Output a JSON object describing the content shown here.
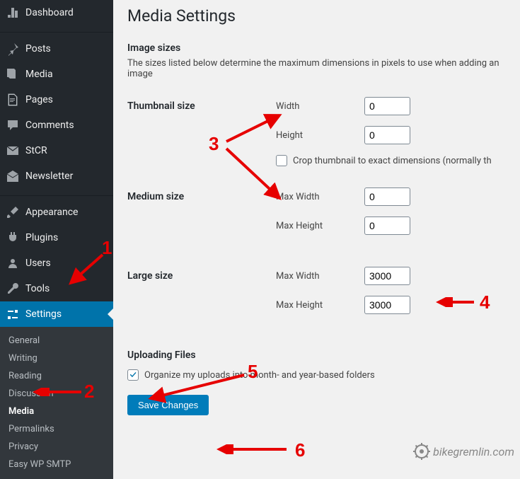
{
  "sidebar": {
    "items": [
      {
        "label": "Dashboard",
        "icon": "dashboard-icon"
      },
      {
        "label": "Posts",
        "icon": "pin-icon"
      },
      {
        "label": "Media",
        "icon": "media-icon"
      },
      {
        "label": "Pages",
        "icon": "page-icon"
      },
      {
        "label": "Comments",
        "icon": "comment-icon"
      },
      {
        "label": "StCR",
        "icon": "email-icon"
      },
      {
        "label": "Newsletter",
        "icon": "envelope-open-icon"
      },
      {
        "label": "Appearance",
        "icon": "brush-icon"
      },
      {
        "label": "Plugins",
        "icon": "plug-icon"
      },
      {
        "label": "Users",
        "icon": "users-icon"
      },
      {
        "label": "Tools",
        "icon": "tools-icon"
      },
      {
        "label": "Settings",
        "icon": "sliders-icon"
      }
    ],
    "submenu": [
      "General",
      "Writing",
      "Reading",
      "Discussion",
      "Media",
      "Permalinks",
      "Privacy",
      "Easy WP SMTP"
    ]
  },
  "page": {
    "title": "Media Settings",
    "section_image_sizes": "Image sizes",
    "desc": "The sizes listed below determine the maximum dimensions in pixels to use when adding an image",
    "thumbnail": {
      "label": "Thumbnail size",
      "width_label": "Width",
      "width_value": "0",
      "height_label": "Height",
      "height_value": "0",
      "crop_label": "Crop thumbnail to exact dimensions (normally th"
    },
    "medium": {
      "label": "Medium size",
      "maxw_label": "Max Width",
      "maxw_value": "0",
      "maxh_label": "Max Height",
      "maxh_value": "0"
    },
    "large": {
      "label": "Large size",
      "maxw_label": "Max Width",
      "maxw_value": "3000",
      "maxh_label": "Max Height",
      "maxh_value": "3000"
    },
    "uploading_heading": "Uploading Files",
    "organize_label": "Organize my uploads into month- and year-based folders",
    "save_label": "Save Changes"
  },
  "annotations": {
    "n1": "1",
    "n2": "2",
    "n3": "3",
    "n4": "4",
    "n5": "5",
    "n6": "6"
  },
  "watermark": "bikegremlin.com"
}
